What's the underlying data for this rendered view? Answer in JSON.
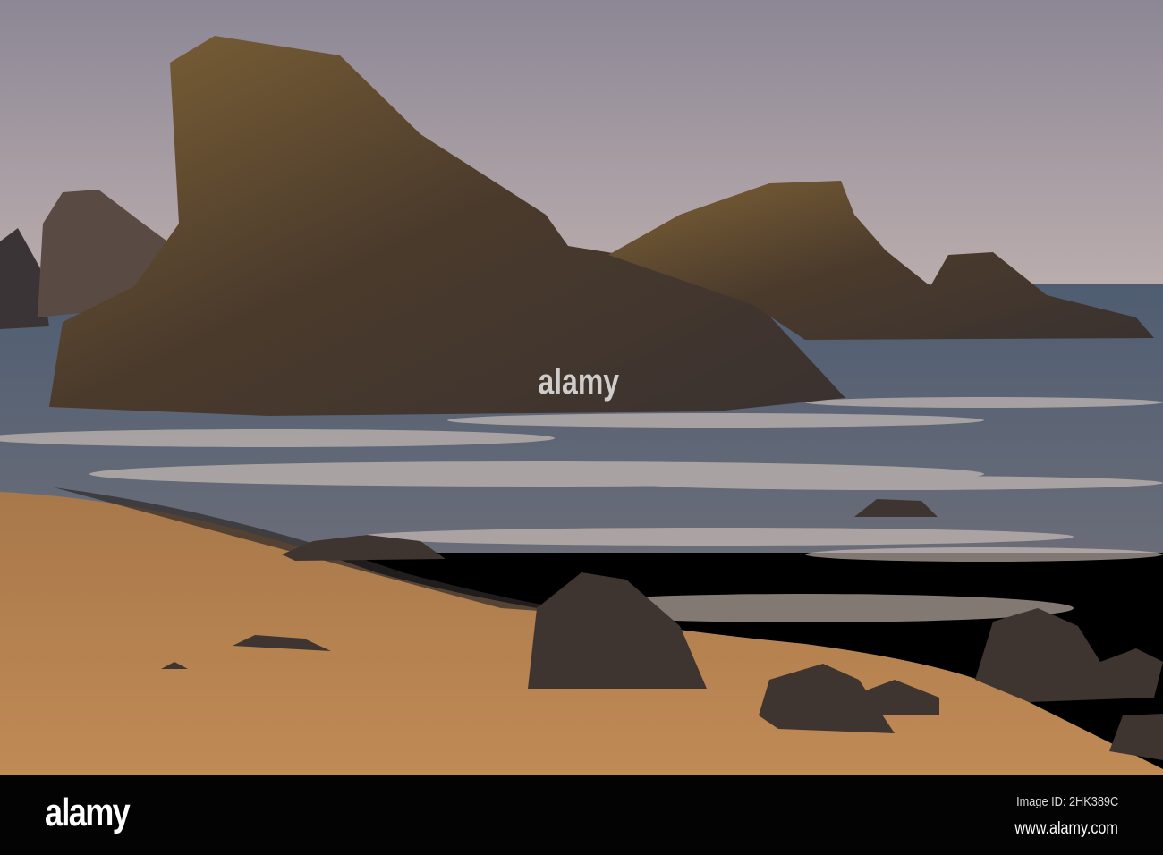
{
  "photo": {
    "subject": "sea stacks on a sandy beach at sunset, long exposure surf",
    "colors": {
      "sky_top": "#8c8795",
      "sky_horizon": "#bcaeae",
      "sea": "#4f5d70",
      "sand": "#b8824f",
      "rock": "#4a3a2c",
      "rock_lit": "#8a6a3a"
    }
  },
  "watermark": {
    "text": "alamy"
  },
  "footer": {
    "logo": "alamy",
    "image_id": "Image ID: 2HK389C",
    "website": "www.alamy.com"
  }
}
